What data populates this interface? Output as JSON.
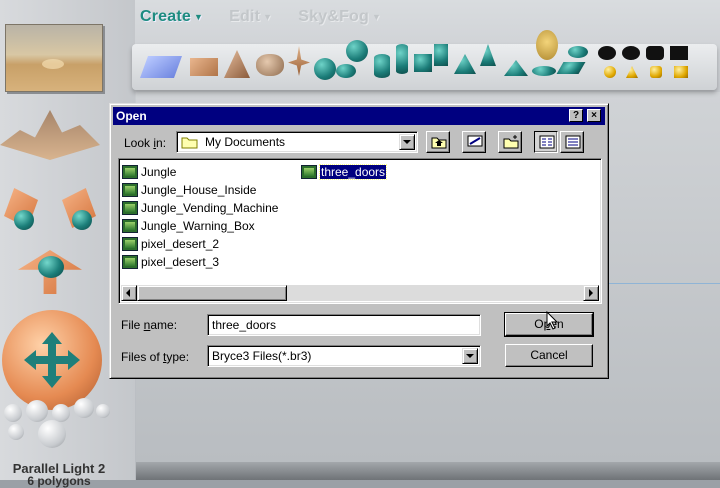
{
  "app": {
    "menus": [
      {
        "label": "Create",
        "state": "active"
      },
      {
        "label": "Edit",
        "state": "dim"
      },
      {
        "label": "Sky&Fog",
        "state": "dim"
      }
    ],
    "light_label": "Parallel Light 2",
    "light_sub": "6 polygons"
  },
  "dialog": {
    "title": "Open",
    "help_glyph": "?",
    "close_glyph": "×",
    "look_in_label": "Look in:",
    "look_in_value": "My Documents",
    "files": [
      {
        "name": "Jungle",
        "selected": false
      },
      {
        "name": "Jungle_House_Inside",
        "selected": false
      },
      {
        "name": "Jungle_Vending_Machine",
        "selected": false
      },
      {
        "name": "Jungle_Warning_Box",
        "selected": false
      },
      {
        "name": "pixel_desert_2",
        "selected": false
      },
      {
        "name": "pixel_desert_3",
        "selected": false
      },
      {
        "name": "three_doors",
        "selected": true
      }
    ],
    "file_name_label": "File name:",
    "file_name_value": "three_doors",
    "file_type_label": "Files of type:",
    "file_type_value": "Bryce3 Files(*.br3)",
    "open_label": "Open",
    "cancel_label": "Cancel"
  },
  "colors": {
    "title_bar": "#000080",
    "selection": "#000080",
    "accent_teal": "#1d8c80"
  }
}
